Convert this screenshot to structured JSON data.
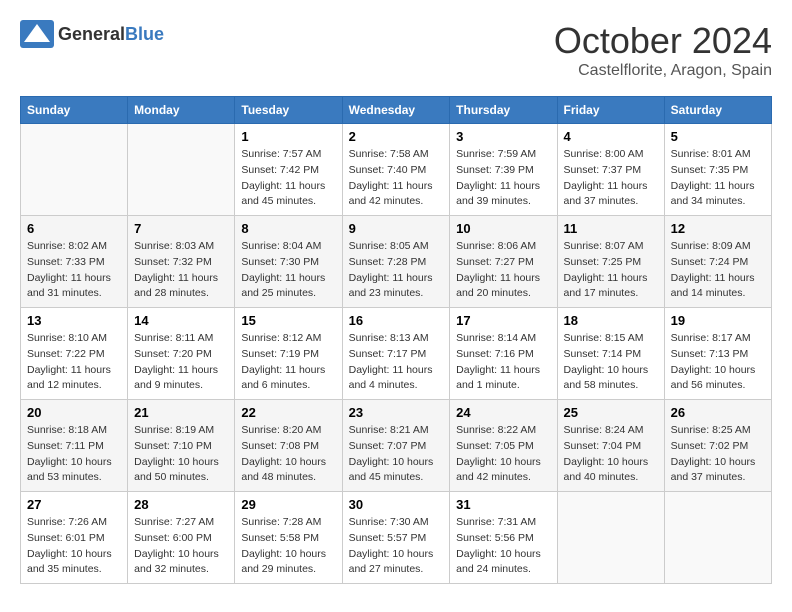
{
  "header": {
    "logo_general": "General",
    "logo_blue": "Blue",
    "month": "October 2024",
    "location": "Castelflorite, Aragon, Spain"
  },
  "days_of_week": [
    "Sunday",
    "Monday",
    "Tuesday",
    "Wednesday",
    "Thursday",
    "Friday",
    "Saturday"
  ],
  "weeks": [
    [
      {
        "day": "",
        "detail": ""
      },
      {
        "day": "",
        "detail": ""
      },
      {
        "day": "1",
        "detail": "Sunrise: 7:57 AM\nSunset: 7:42 PM\nDaylight: 11 hours and 45 minutes."
      },
      {
        "day": "2",
        "detail": "Sunrise: 7:58 AM\nSunset: 7:40 PM\nDaylight: 11 hours and 42 minutes."
      },
      {
        "day": "3",
        "detail": "Sunrise: 7:59 AM\nSunset: 7:39 PM\nDaylight: 11 hours and 39 minutes."
      },
      {
        "day": "4",
        "detail": "Sunrise: 8:00 AM\nSunset: 7:37 PM\nDaylight: 11 hours and 37 minutes."
      },
      {
        "day": "5",
        "detail": "Sunrise: 8:01 AM\nSunset: 7:35 PM\nDaylight: 11 hours and 34 minutes."
      }
    ],
    [
      {
        "day": "6",
        "detail": "Sunrise: 8:02 AM\nSunset: 7:33 PM\nDaylight: 11 hours and 31 minutes."
      },
      {
        "day": "7",
        "detail": "Sunrise: 8:03 AM\nSunset: 7:32 PM\nDaylight: 11 hours and 28 minutes."
      },
      {
        "day": "8",
        "detail": "Sunrise: 8:04 AM\nSunset: 7:30 PM\nDaylight: 11 hours and 25 minutes."
      },
      {
        "day": "9",
        "detail": "Sunrise: 8:05 AM\nSunset: 7:28 PM\nDaylight: 11 hours and 23 minutes."
      },
      {
        "day": "10",
        "detail": "Sunrise: 8:06 AM\nSunset: 7:27 PM\nDaylight: 11 hours and 20 minutes."
      },
      {
        "day": "11",
        "detail": "Sunrise: 8:07 AM\nSunset: 7:25 PM\nDaylight: 11 hours and 17 minutes."
      },
      {
        "day": "12",
        "detail": "Sunrise: 8:09 AM\nSunset: 7:24 PM\nDaylight: 11 hours and 14 minutes."
      }
    ],
    [
      {
        "day": "13",
        "detail": "Sunrise: 8:10 AM\nSunset: 7:22 PM\nDaylight: 11 hours and 12 minutes."
      },
      {
        "day": "14",
        "detail": "Sunrise: 8:11 AM\nSunset: 7:20 PM\nDaylight: 11 hours and 9 minutes."
      },
      {
        "day": "15",
        "detail": "Sunrise: 8:12 AM\nSunset: 7:19 PM\nDaylight: 11 hours and 6 minutes."
      },
      {
        "day": "16",
        "detail": "Sunrise: 8:13 AM\nSunset: 7:17 PM\nDaylight: 11 hours and 4 minutes."
      },
      {
        "day": "17",
        "detail": "Sunrise: 8:14 AM\nSunset: 7:16 PM\nDaylight: 11 hours and 1 minute."
      },
      {
        "day": "18",
        "detail": "Sunrise: 8:15 AM\nSunset: 7:14 PM\nDaylight: 10 hours and 58 minutes."
      },
      {
        "day": "19",
        "detail": "Sunrise: 8:17 AM\nSunset: 7:13 PM\nDaylight: 10 hours and 56 minutes."
      }
    ],
    [
      {
        "day": "20",
        "detail": "Sunrise: 8:18 AM\nSunset: 7:11 PM\nDaylight: 10 hours and 53 minutes."
      },
      {
        "day": "21",
        "detail": "Sunrise: 8:19 AM\nSunset: 7:10 PM\nDaylight: 10 hours and 50 minutes."
      },
      {
        "day": "22",
        "detail": "Sunrise: 8:20 AM\nSunset: 7:08 PM\nDaylight: 10 hours and 48 minutes."
      },
      {
        "day": "23",
        "detail": "Sunrise: 8:21 AM\nSunset: 7:07 PM\nDaylight: 10 hours and 45 minutes."
      },
      {
        "day": "24",
        "detail": "Sunrise: 8:22 AM\nSunset: 7:05 PM\nDaylight: 10 hours and 42 minutes."
      },
      {
        "day": "25",
        "detail": "Sunrise: 8:24 AM\nSunset: 7:04 PM\nDaylight: 10 hours and 40 minutes."
      },
      {
        "day": "26",
        "detail": "Sunrise: 8:25 AM\nSunset: 7:02 PM\nDaylight: 10 hours and 37 minutes."
      }
    ],
    [
      {
        "day": "27",
        "detail": "Sunrise: 7:26 AM\nSunset: 6:01 PM\nDaylight: 10 hours and 35 minutes."
      },
      {
        "day": "28",
        "detail": "Sunrise: 7:27 AM\nSunset: 6:00 PM\nDaylight: 10 hours and 32 minutes."
      },
      {
        "day": "29",
        "detail": "Sunrise: 7:28 AM\nSunset: 5:58 PM\nDaylight: 10 hours and 29 minutes."
      },
      {
        "day": "30",
        "detail": "Sunrise: 7:30 AM\nSunset: 5:57 PM\nDaylight: 10 hours and 27 minutes."
      },
      {
        "day": "31",
        "detail": "Sunrise: 7:31 AM\nSunset: 5:56 PM\nDaylight: 10 hours and 24 minutes."
      },
      {
        "day": "",
        "detail": ""
      },
      {
        "day": "",
        "detail": ""
      }
    ]
  ]
}
